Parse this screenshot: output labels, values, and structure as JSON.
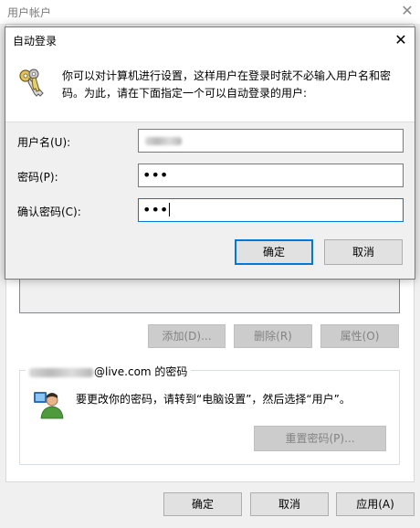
{
  "background_window": {
    "title": "用户帐户",
    "buttons": {
      "add": "添加(D)...",
      "delete": "删除(R)",
      "properties": "属性(O)"
    },
    "password_group": {
      "label_suffix": "@live.com 的密码",
      "hint": "要更改你的密码，请转到“电脑设置”，然后选择“用户”。",
      "reset_button": "重置密码(P)..."
    },
    "footer": {
      "ok": "确定",
      "cancel": "取消",
      "apply": "应用(A)"
    }
  },
  "dialog": {
    "title": "自动登录",
    "description": "你可以对计算机进行设置，这样用户在登录时就不必输入用户名和密码。为此，请在下面指定一个可以自动登录的用户:",
    "fields": {
      "username_label": "用户名(U):",
      "password_label": "密码(P):",
      "confirm_label": "确认密码(C):",
      "password_value": "•••",
      "confirm_value": "•••"
    },
    "buttons": {
      "ok": "确定",
      "cancel": "取消"
    }
  },
  "colors": {
    "accent": "#0078d7",
    "disabled_text": "#838383"
  }
}
